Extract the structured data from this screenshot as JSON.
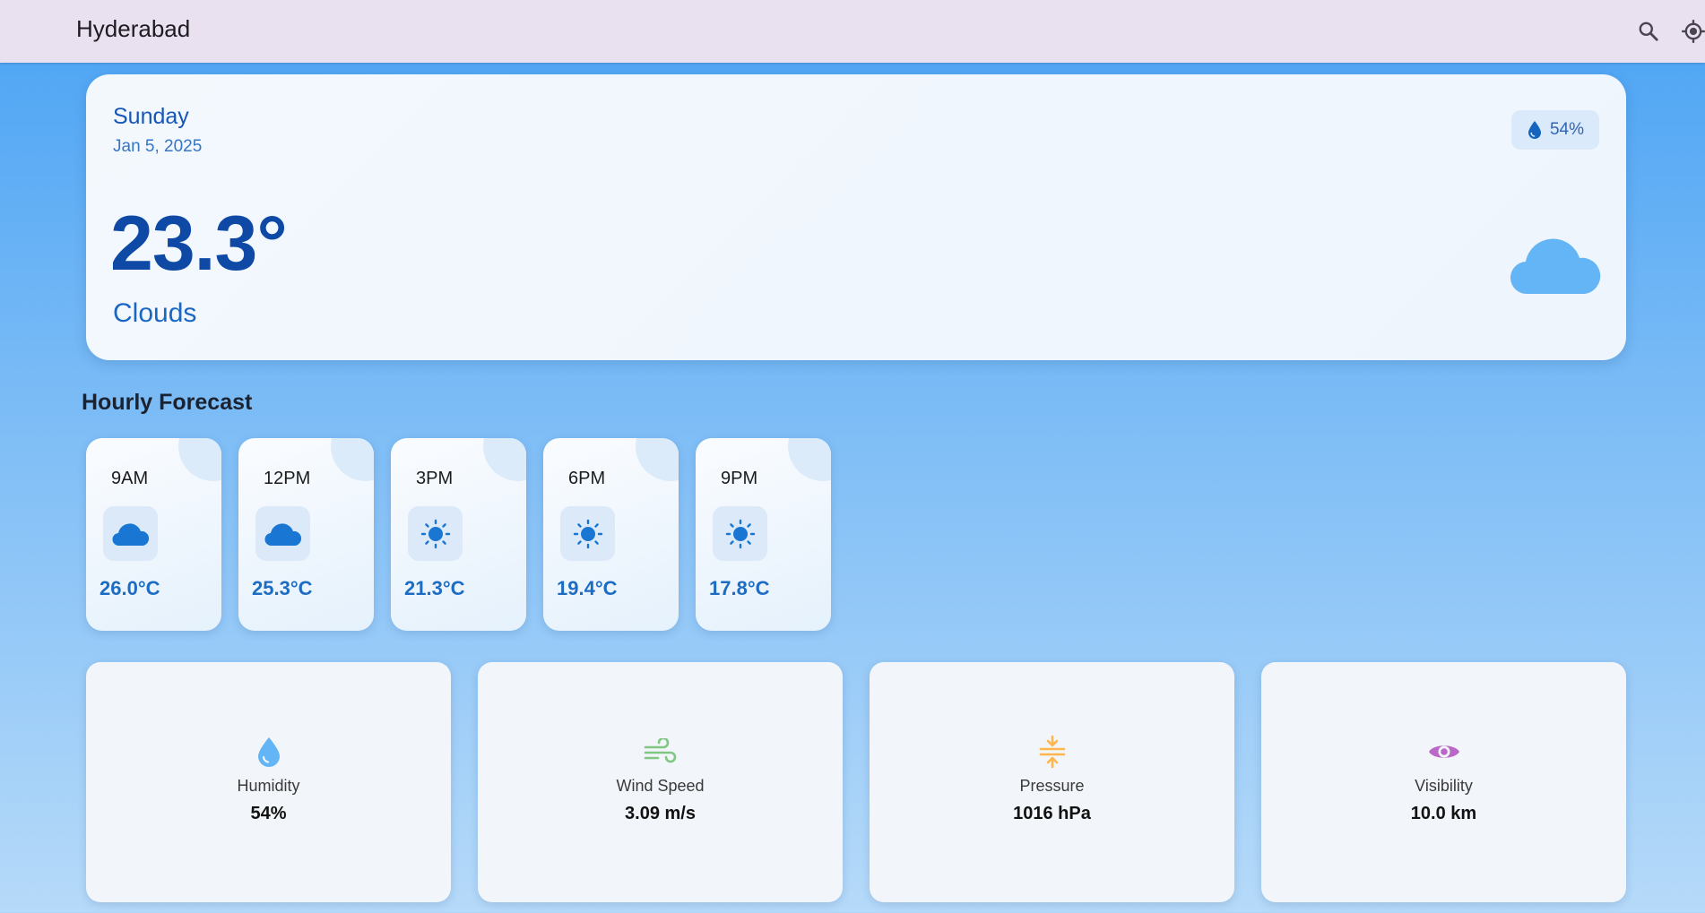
{
  "header": {
    "city": "Hyderabad"
  },
  "current": {
    "day": "Sunday",
    "date": "Jan 5, 2025",
    "humidity": "54%",
    "temperature": "23.3°",
    "condition": "Clouds"
  },
  "hourly": {
    "title": "Hourly Forecast",
    "items": [
      {
        "time": "9AM",
        "icon": "cloud-icon",
        "temp": "26.0°C"
      },
      {
        "time": "12PM",
        "icon": "cloud-icon",
        "temp": "25.3°C"
      },
      {
        "time": "3PM",
        "icon": "sun-icon",
        "temp": "21.3°C"
      },
      {
        "time": "6PM",
        "icon": "sun-icon",
        "temp": "19.4°C"
      },
      {
        "time": "9PM",
        "icon": "sun-icon",
        "temp": "17.8°C"
      }
    ]
  },
  "stats": [
    {
      "label": "Humidity",
      "value": "54%",
      "icon": "water-drop-icon",
      "color": "#64b5f6"
    },
    {
      "label": "Wind Speed",
      "value": "3.09 m/s",
      "icon": "wind-icon",
      "color": "#81c784"
    },
    {
      "label": "Pressure",
      "value": "1016 hPa",
      "icon": "compress-icon",
      "color": "#ffb74d"
    },
    {
      "label": "Visibility",
      "value": "10.0 km",
      "icon": "eye-icon",
      "color": "#ba68c8"
    }
  ],
  "colors": {
    "primary": "#1565c0",
    "accent_icon": "#1976d2",
    "cloud": "#64b5f6",
    "appbar": "#e9e0f0"
  }
}
